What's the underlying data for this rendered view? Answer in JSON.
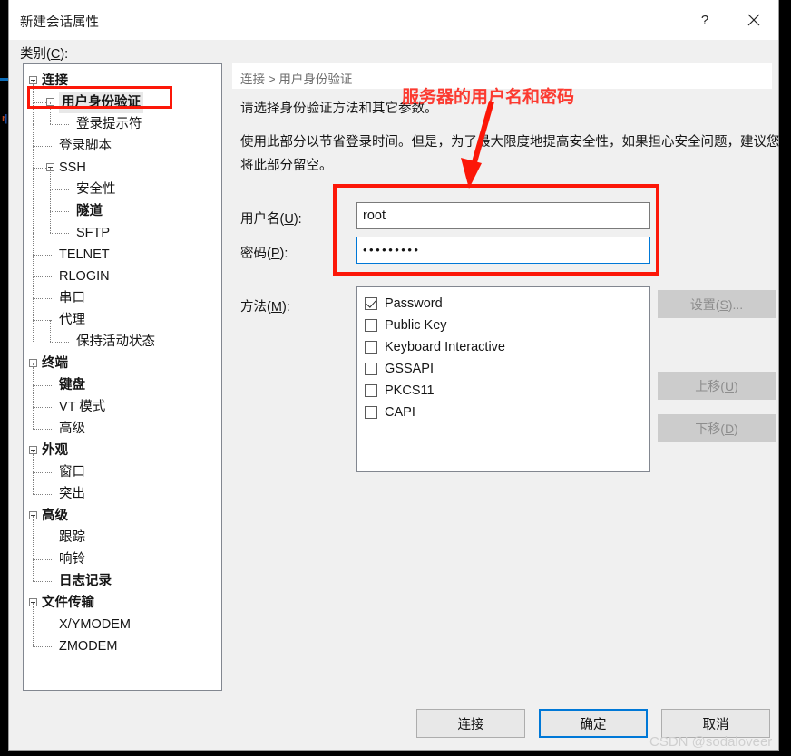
{
  "window": {
    "title": "新建会话属性",
    "help_icon": "?",
    "close_icon": "close-icon"
  },
  "category_label": "类别(C):",
  "tree": {
    "nodes": [
      {
        "label": "连接",
        "depth": 0,
        "bold": true,
        "expander": true,
        "selected": false
      },
      {
        "label": "用户身份验证",
        "depth": 1,
        "bold": true,
        "expander": true,
        "selected": true
      },
      {
        "label": "登录提示符",
        "depth": 2,
        "bold": false,
        "expander": false,
        "selected": false
      },
      {
        "label": "登录脚本",
        "depth": 1,
        "bold": false,
        "expander": false,
        "selected": false
      },
      {
        "label": "SSH",
        "depth": 1,
        "bold": false,
        "expander": true,
        "selected": false
      },
      {
        "label": "安全性",
        "depth": 2,
        "bold": false,
        "expander": false,
        "selected": false
      },
      {
        "label": "隧道",
        "depth": 2,
        "bold": true,
        "expander": false,
        "selected": false
      },
      {
        "label": "SFTP",
        "depth": 2,
        "bold": false,
        "expander": false,
        "selected": false
      },
      {
        "label": "TELNET",
        "depth": 1,
        "bold": false,
        "expander": false,
        "selected": false
      },
      {
        "label": "RLOGIN",
        "depth": 1,
        "bold": false,
        "expander": false,
        "selected": false
      },
      {
        "label": "串口",
        "depth": 1,
        "bold": false,
        "expander": false,
        "selected": false
      },
      {
        "label": "代理",
        "depth": 1,
        "bold": false,
        "expander": false,
        "selected": false
      },
      {
        "label": "保持活动状态",
        "depth": 2,
        "bold": false,
        "expander": false,
        "selected": false
      },
      {
        "label": "终端",
        "depth": 0,
        "bold": true,
        "expander": true,
        "selected": false
      },
      {
        "label": "键盘",
        "depth": 1,
        "bold": true,
        "expander": false,
        "selected": false
      },
      {
        "label": "VT 模式",
        "depth": 1,
        "bold": false,
        "expander": false,
        "selected": false
      },
      {
        "label": "高级",
        "depth": 1,
        "bold": false,
        "expander": false,
        "selected": false
      },
      {
        "label": "外观",
        "depth": 0,
        "bold": true,
        "expander": true,
        "selected": false
      },
      {
        "label": "窗口",
        "depth": 1,
        "bold": false,
        "expander": false,
        "selected": false
      },
      {
        "label": "突出",
        "depth": 1,
        "bold": false,
        "expander": false,
        "selected": false
      },
      {
        "label": "高级",
        "depth": 0,
        "bold": true,
        "expander": true,
        "selected": false
      },
      {
        "label": "跟踪",
        "depth": 1,
        "bold": false,
        "expander": false,
        "selected": false
      },
      {
        "label": "响铃",
        "depth": 1,
        "bold": false,
        "expander": false,
        "selected": false
      },
      {
        "label": "日志记录",
        "depth": 1,
        "bold": true,
        "expander": false,
        "selected": false
      },
      {
        "label": "文件传输",
        "depth": 0,
        "bold": true,
        "expander": true,
        "selected": false
      },
      {
        "label": "X/YMODEM",
        "depth": 1,
        "bold": false,
        "expander": false,
        "selected": false
      },
      {
        "label": "ZMODEM",
        "depth": 1,
        "bold": false,
        "expander": false,
        "selected": false
      }
    ]
  },
  "content": {
    "breadcrumb": "连接 > 用户身份验证",
    "description_1": "请选择身份验证方法和其它参数。",
    "description_2": "使用此部分以节省登录时间。但是，为了最大限度地提高安全性，如果担心安全问题，建议您将此部分留空。",
    "username_label": "用户名(U):",
    "username_value": "root",
    "password_label": "密码(P):",
    "password_value": "•••••••••",
    "methods_label": "方法(M):",
    "methods": [
      {
        "label": "Password",
        "checked": true
      },
      {
        "label": "Public Key",
        "checked": false
      },
      {
        "label": "Keyboard Interactive",
        "checked": false
      },
      {
        "label": "GSSAPI",
        "checked": false
      },
      {
        "label": "PKCS11",
        "checked": false
      },
      {
        "label": "CAPI",
        "checked": false
      }
    ],
    "side_buttons": {
      "settings": "设置(S)...",
      "move_up": "上移(U)",
      "move_down": "下移(D)"
    }
  },
  "footer": {
    "connect": "连接",
    "ok": "确定",
    "cancel": "取消"
  },
  "annotations": {
    "note_text": "服务器的用户名和密码",
    "highlight_color": "#fc1708"
  },
  "watermark": "CSDN @sodaloveer"
}
